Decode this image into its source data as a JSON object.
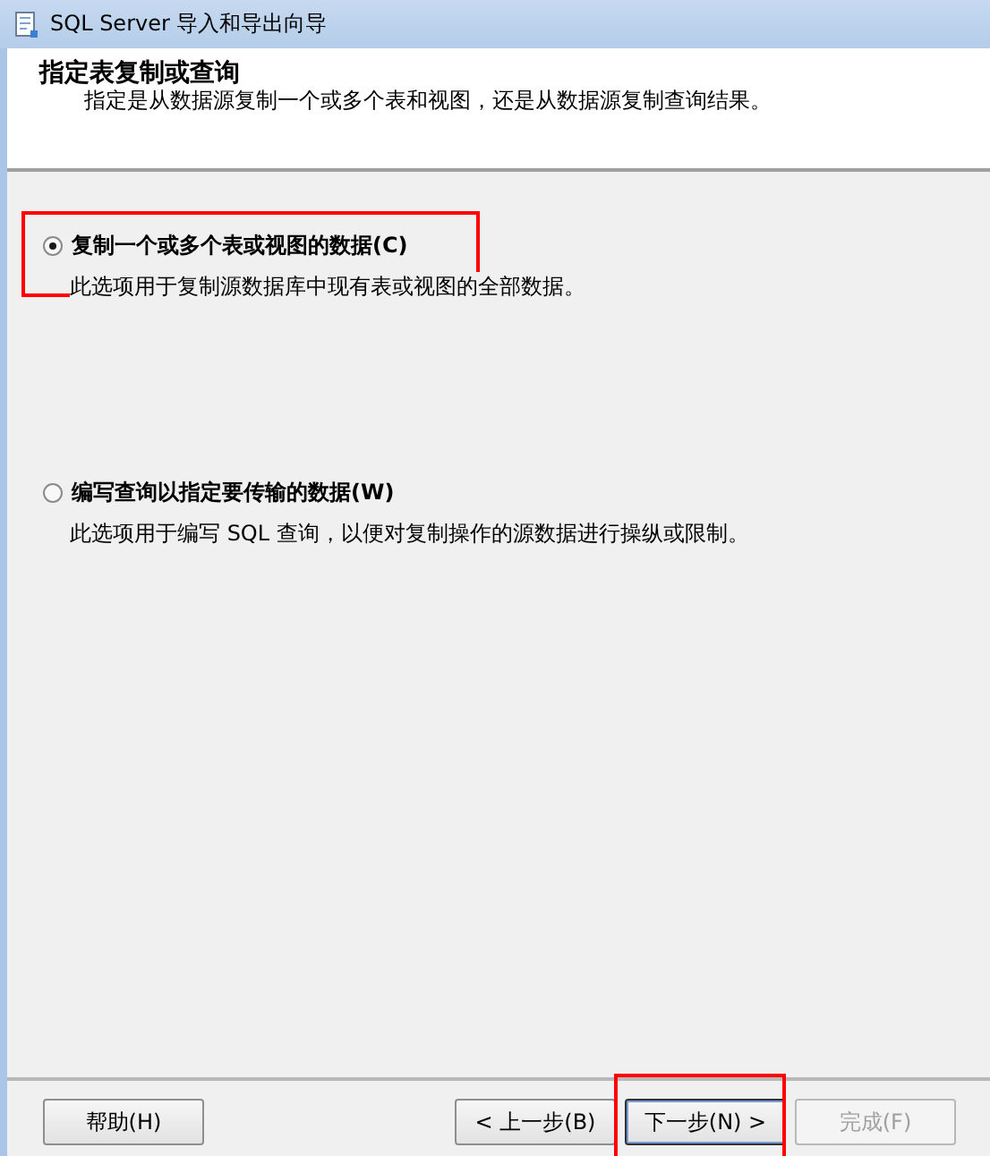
{
  "window": {
    "title": "SQL Server 导入和导出向导"
  },
  "header": {
    "title": "指定表复制或查询",
    "subtitle": "指定是从数据源复制一个或多个表和视图，还是从数据源复制查询结果。"
  },
  "options": [
    {
      "label": "复制一个或多个表或视图的数据(C)",
      "description": "此选项用于复制源数据库中现有表或视图的全部数据。",
      "selected": true,
      "highlighted": true
    },
    {
      "label": "编写查询以指定要传输的数据(W)",
      "description": "此选项用于编写 SQL 查询，以便对复制操作的源数据进行操纵或限制。",
      "selected": false,
      "highlighted": false
    }
  ],
  "buttons": [
    {
      "label": "帮助(H)",
      "disabled": false,
      "highlighted": false
    },
    {
      "label": "< 上一步(B)",
      "disabled": false,
      "highlighted": false
    },
    {
      "label": "下一步(N) >",
      "disabled": false,
      "highlighted": true
    },
    {
      "label": "完成(F)",
      "disabled": true,
      "highlighted": false
    }
  ]
}
